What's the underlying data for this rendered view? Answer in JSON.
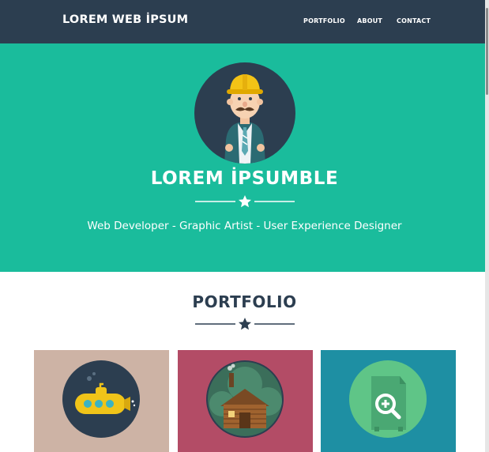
{
  "navbar": {
    "brand": "LOREM WEB İPSUM",
    "links": [
      "PORTFOLIO",
      "ABOUT",
      "CONTACT"
    ]
  },
  "hero": {
    "name": "LOREM İPSUMBLE",
    "tagline": "Web Developer - Graphic Artist - User Experience Designer",
    "avatar_icon": "cartoon-man-hardhat-icon"
  },
  "portfolio": {
    "title": "PORTFOLIO",
    "items": [
      {
        "icon": "submarine-icon",
        "bg": "#cdb3a5"
      },
      {
        "icon": "log-cabin-icon",
        "bg": "#b34c66"
      },
      {
        "icon": "safe-magnifier-icon",
        "bg": "#1e8fa3"
      }
    ]
  },
  "colors": {
    "navbar": "#2c3e50",
    "hero": "#1abc9c",
    "heading": "#2c3e50"
  }
}
